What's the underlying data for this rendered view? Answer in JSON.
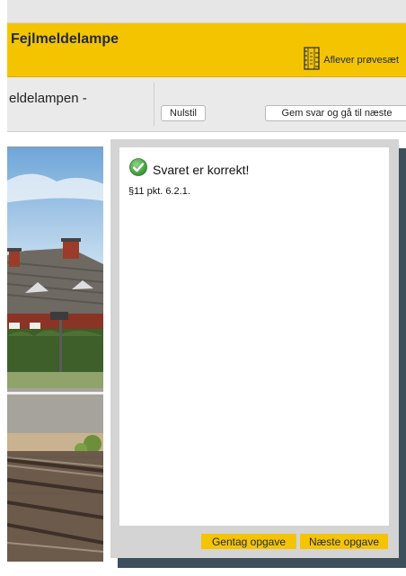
{
  "header": {
    "title": "Fejlmeldelampe",
    "hand_in_label": "Aflever prøvesæt"
  },
  "question": {
    "title_fragment": "eldelampen -"
  },
  "toolbar": {
    "reset_label": "Nulstil",
    "save_next_label": "Gem svar og gå til næste"
  },
  "result": {
    "status": "Svaret er korrekt!",
    "reference": "§11 pkt. 6.2.1.",
    "repeat_label": "Gentag opgave",
    "next_label": "Næste opgave"
  },
  "colors": {
    "accent": "#f5c400",
    "success": "#3aa33a",
    "shadow": "#3d4f5a"
  },
  "icons": {
    "hand_in": "ruler-document-icon",
    "status": "check-circle-icon"
  }
}
